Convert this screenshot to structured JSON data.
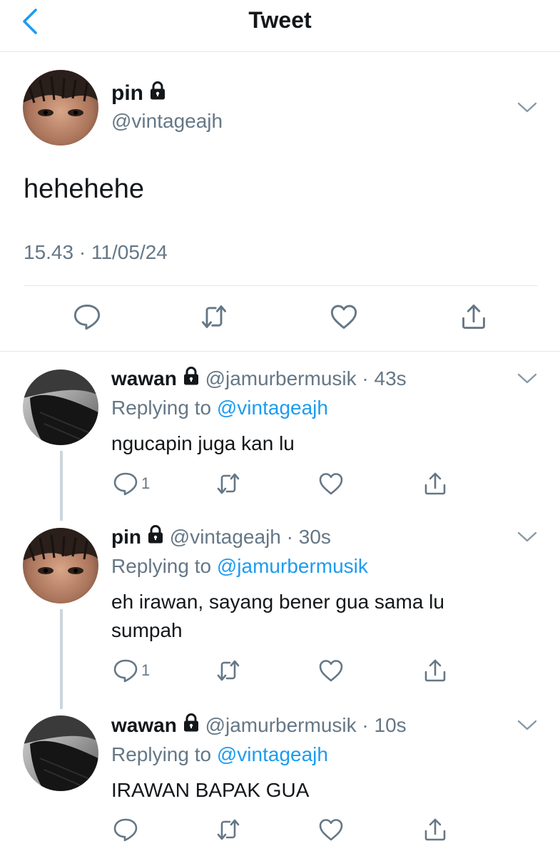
{
  "header": {
    "title": "Tweet"
  },
  "main_tweet": {
    "name": "pin",
    "handle": "@vintageajh",
    "text": "hehehehe",
    "meta": "15.43 · 11/05/24"
  },
  "replies": [
    {
      "name": "wawan",
      "handle": "@jamurbermusik",
      "time": "· 43s",
      "replying_prefix": "Replying to",
      "replying_to": "@vintageajh",
      "text": "ngucapin juga kan lu",
      "reply_count": "1"
    },
    {
      "name": "pin",
      "handle": "@vintageajh",
      "time": "· 30s",
      "replying_prefix": "Replying to",
      "replying_to": "@jamurbermusik",
      "text": "eh irawan, sayang bener gua sama lu sumpah",
      "reply_count": "1"
    },
    {
      "name": "wawan",
      "handle": "@jamurbermusik",
      "time": "· 10s",
      "replying_prefix": "Replying to",
      "replying_to": "@vintageajh",
      "text": "IRAWAN BAPAK GUA",
      "reply_count": ""
    }
  ],
  "icons": {
    "back": "chevron-left-icon",
    "lock": "lock-icon",
    "caret": "chevron-down-icon",
    "reply": "reply-bubble-icon",
    "retweet": "retweet-icon",
    "like": "heart-icon",
    "share": "share-icon"
  },
  "colors": {
    "accent": "#1d9bf0",
    "secondary_text": "#657786",
    "divider": "#e1e8ed",
    "thread_line": "#ccd6dd"
  }
}
